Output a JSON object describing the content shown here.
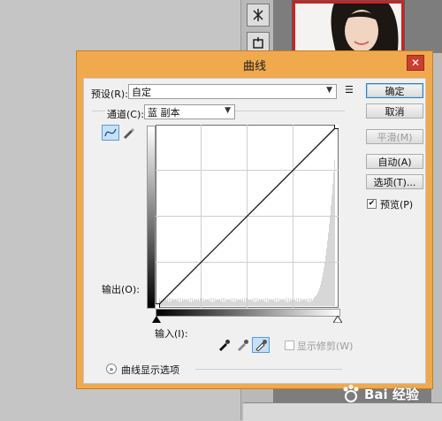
{
  "dialog": {
    "title": "曲线",
    "close_glyph": "✕",
    "preset": {
      "label": "预设(R):",
      "value": "自定",
      "menu_glyph": "☰"
    },
    "channel": {
      "label": "通道(C):",
      "value": "蓝 副本"
    },
    "output_label": "输出(O):",
    "input_label": "输入(I):",
    "buttons": {
      "ok": "确定",
      "cancel": "取消",
      "smooth": "平滑(M)",
      "auto": "自动(A)",
      "options": "选项(T)..."
    },
    "preview": {
      "label": "预览(P)",
      "checked": true
    },
    "show_clipping": {
      "label": "显示修剪(W)",
      "checked": false
    },
    "curve_display_options": "曲线显示选项",
    "curve": {
      "points": [
        [
          0,
          0
        ],
        [
          255,
          255
        ]
      ]
    }
  },
  "watermark": {
    "text": "Bai 经验"
  }
}
